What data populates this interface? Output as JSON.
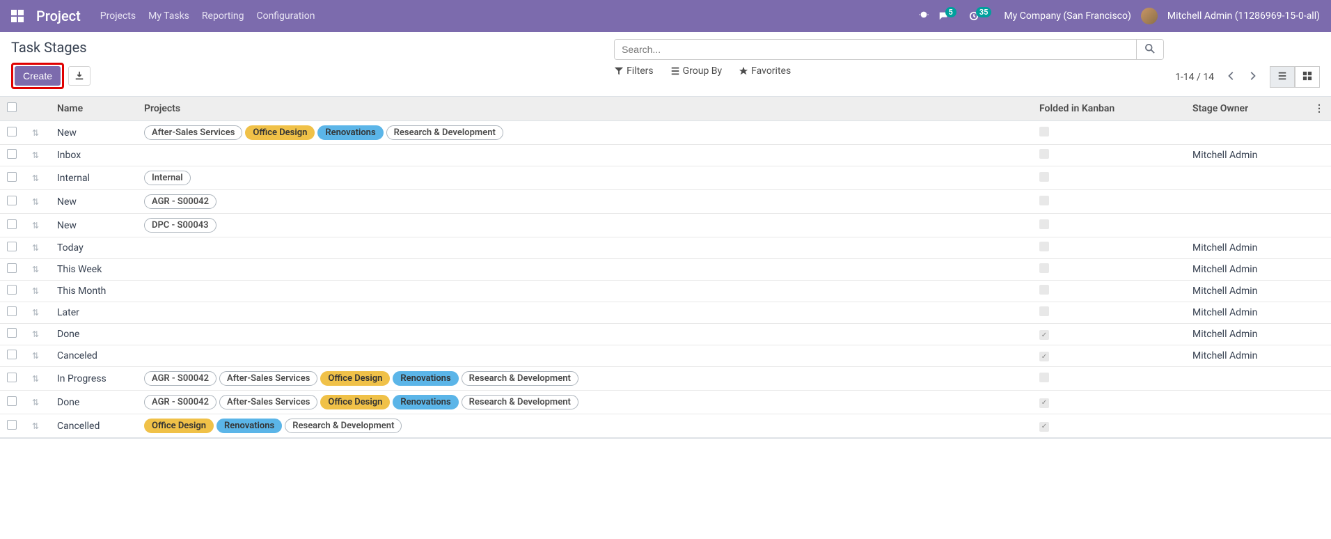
{
  "nav": {
    "brand": "Project",
    "links": [
      "Projects",
      "My Tasks",
      "Reporting",
      "Configuration"
    ],
    "messages_count": "5",
    "activities_count": "35",
    "company": "My Company (San Francisco)",
    "username": "Mitchell Admin (11286969-15-0-all)"
  },
  "page": {
    "title": "Task Stages",
    "create_label": "Create",
    "search_placeholder": "Search...",
    "filters_label": "Filters",
    "groupby_label": "Group By",
    "favorites_label": "Favorites",
    "pager_text": "1-14 / 14"
  },
  "columns": {
    "name": "Name",
    "projects": "Projects",
    "folded": "Folded in Kanban",
    "owner": "Stage Owner"
  },
  "tag_colors": {
    "After-Sales Services": "default",
    "Office Design": "yellow",
    "Renovations": "blue",
    "Research & Development": "default",
    "Internal": "default",
    "AGR - S00042": "default",
    "DPC - S00043": "default"
  },
  "rows": [
    {
      "name": "New",
      "tags": [
        "After-Sales Services",
        "Office Design",
        "Renovations",
        "Research & Development"
      ],
      "folded": false,
      "owner": ""
    },
    {
      "name": "Inbox",
      "tags": [],
      "folded": false,
      "owner": "Mitchell Admin"
    },
    {
      "name": "Internal",
      "tags": [
        "Internal"
      ],
      "folded": false,
      "owner": ""
    },
    {
      "name": "New",
      "tags": [
        "AGR - S00042"
      ],
      "folded": false,
      "owner": ""
    },
    {
      "name": "New",
      "tags": [
        "DPC - S00043"
      ],
      "folded": false,
      "owner": ""
    },
    {
      "name": "Today",
      "tags": [],
      "folded": false,
      "owner": "Mitchell Admin"
    },
    {
      "name": "This Week",
      "tags": [],
      "folded": false,
      "owner": "Mitchell Admin"
    },
    {
      "name": "This Month",
      "tags": [],
      "folded": false,
      "owner": "Mitchell Admin"
    },
    {
      "name": "Later",
      "tags": [],
      "folded": false,
      "owner": "Mitchell Admin"
    },
    {
      "name": "Done",
      "tags": [],
      "folded": true,
      "owner": "Mitchell Admin"
    },
    {
      "name": "Canceled",
      "tags": [],
      "folded": true,
      "owner": "Mitchell Admin"
    },
    {
      "name": "In Progress",
      "tags": [
        "AGR - S00042",
        "After-Sales Services",
        "Office Design",
        "Renovations",
        "Research & Development"
      ],
      "folded": false,
      "owner": ""
    },
    {
      "name": "Done",
      "tags": [
        "AGR - S00042",
        "After-Sales Services",
        "Office Design",
        "Renovations",
        "Research & Development"
      ],
      "folded": true,
      "owner": ""
    },
    {
      "name": "Cancelled",
      "tags": [
        "Office Design",
        "Renovations",
        "Research & Development"
      ],
      "folded": true,
      "owner": ""
    }
  ]
}
